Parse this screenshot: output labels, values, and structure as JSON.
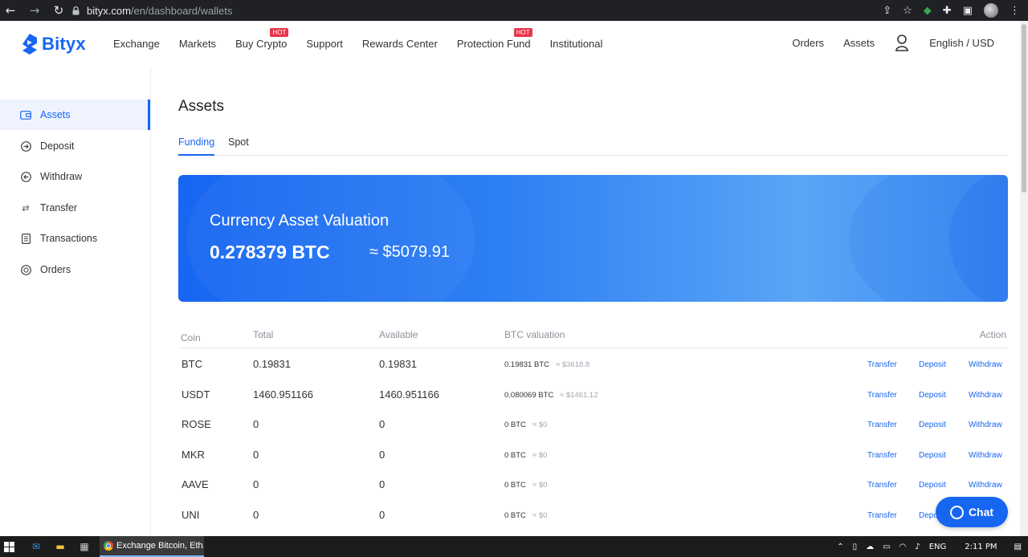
{
  "browser": {
    "url_domain": "bityx.com",
    "url_path": "/en/dashboard/wallets"
  },
  "header": {
    "logo_text": "Bityx",
    "nav": [
      {
        "label": "Exchange",
        "badge": ""
      },
      {
        "label": "Markets",
        "badge": ""
      },
      {
        "label": "Buy Crypto",
        "badge": "HOT"
      },
      {
        "label": "Support",
        "badge": ""
      },
      {
        "label": "Rewards Center",
        "badge": ""
      },
      {
        "label": "Protection Fund",
        "badge": "HOT"
      },
      {
        "label": "Institutional",
        "badge": ""
      }
    ],
    "orders_label": "Orders",
    "assets_label": "Assets",
    "language_label": "English / USD"
  },
  "sidebar": {
    "items": [
      {
        "label": "Assets",
        "icon": "wallet-icon",
        "active": true
      },
      {
        "label": "Deposit",
        "icon": "deposit-icon",
        "active": false
      },
      {
        "label": "Withdraw",
        "icon": "withdraw-icon",
        "active": false
      },
      {
        "label": "Transfer",
        "icon": "transfer-icon",
        "active": false
      },
      {
        "label": "Transactions",
        "icon": "transactions-icon",
        "active": false
      },
      {
        "label": "Orders",
        "icon": "orders-icon",
        "active": false
      }
    ]
  },
  "main": {
    "title": "Assets",
    "tabs": [
      {
        "label": "Funding",
        "active": true
      },
      {
        "label": "Spot",
        "active": false
      }
    ],
    "banner": {
      "title": "Currency Asset Valuation",
      "btc_value": "0.278379 BTC",
      "usd_value": "≈ $5079.91"
    },
    "table": {
      "headers": {
        "coin": "Coin",
        "total": "Total",
        "available": "Available",
        "btc_valuation": "BTC valuation",
        "action": "Action"
      },
      "rows": [
        {
          "coin": "BTC",
          "total": "0.19831",
          "available": "0.19831",
          "btc": "0.19831 BTC",
          "usd": "≈ $3618.8"
        },
        {
          "coin": "USDT",
          "total": "1460.951166",
          "available": "1460.951166",
          "btc": "0.080069 BTC",
          "usd": "≈ $1461.12"
        },
        {
          "coin": "ROSE",
          "total": "0",
          "available": "0",
          "btc": "0 BTC",
          "usd": "≈ $0"
        },
        {
          "coin": "MKR",
          "total": "0",
          "available": "0",
          "btc": "0 BTC",
          "usd": "≈ $0"
        },
        {
          "coin": "AAVE",
          "total": "0",
          "available": "0",
          "btc": "0 BTC",
          "usd": "≈ $0"
        },
        {
          "coin": "UNI",
          "total": "0",
          "available": "0",
          "btc": "0 BTC",
          "usd": "≈ $0"
        }
      ],
      "actions": {
        "transfer": "Transfer",
        "deposit": "Deposit",
        "withdraw": "Withdraw"
      }
    },
    "chat_label": "Chat"
  },
  "taskbar": {
    "app_label": "Exchange Bitcoin, Eth...",
    "language": "ENG",
    "time": "2:11 PM"
  },
  "colors": {
    "accent": "#1766f1",
    "hot_badge": "#e8334a"
  }
}
